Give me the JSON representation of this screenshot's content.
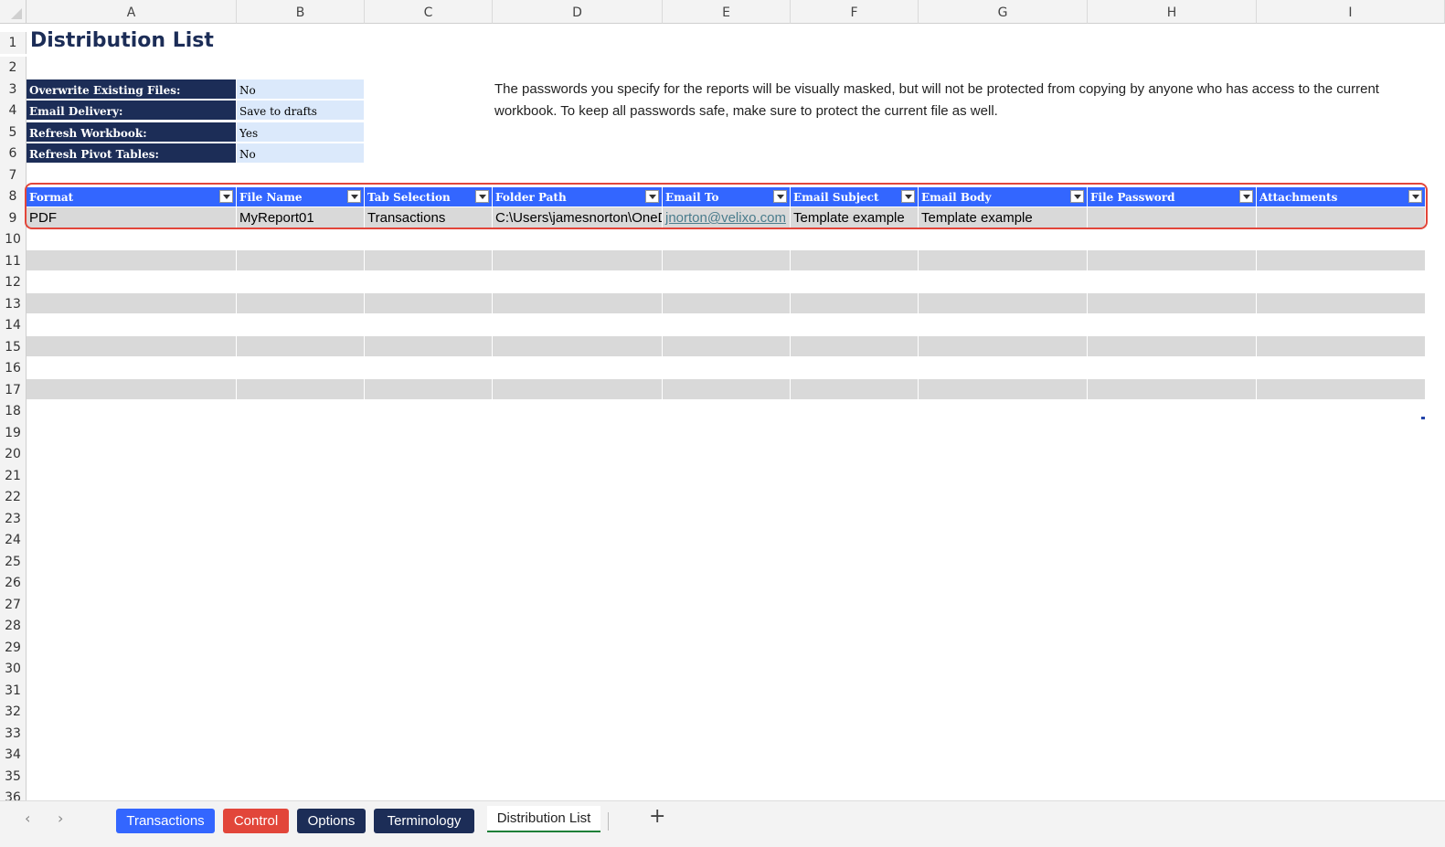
{
  "columns": [
    "A",
    "B",
    "C",
    "D",
    "E",
    "F",
    "G",
    "H",
    "I"
  ],
  "rows": [
    "1",
    "2",
    "3",
    "4",
    "5",
    "6",
    "7",
    "8",
    "9",
    "10",
    "11",
    "12",
    "13",
    "14",
    "15",
    "16",
    "17",
    "18",
    "19",
    "20",
    "21",
    "22",
    "23",
    "24",
    "25",
    "26",
    "27",
    "28",
    "29",
    "30",
    "31",
    "32",
    "33",
    "34",
    "35",
    "36"
  ],
  "title": "Distribution List",
  "settings": [
    {
      "label": "Overwrite Existing Files:",
      "value": "No"
    },
    {
      "label": "Email Delivery:",
      "value": "Save to drafts"
    },
    {
      "label": "Refresh Workbook:",
      "value": "Yes"
    },
    {
      "label": "Refresh Pivot Tables:",
      "value": "No"
    }
  ],
  "note": "The passwords you specify for the reports will be visually masked, but will not be protected from copying by anyone who has access to the current workbook. To keep all passwords safe, make sure to protect the current file as well.",
  "table": {
    "headers": [
      "Format",
      "File Name",
      "Tab Selection",
      "Folder Path",
      "Email To",
      "Email Subject",
      "Email Body",
      "File Password",
      "Attachments"
    ],
    "row": [
      "PDF",
      "MyReport01",
      "Transactions",
      "C:\\Users\\jamesnorton\\OneDrive",
      "jnorton@velixo.com",
      "Template example",
      "Template example",
      "",
      ""
    ]
  },
  "sheet_tabs": [
    {
      "label": "Transactions",
      "color": "#3366ff"
    },
    {
      "label": "Control",
      "color": "#e2463a"
    },
    {
      "label": "Options",
      "color": "#1c2d57"
    },
    {
      "label": "Terminology",
      "color": "#1c2d57"
    },
    {
      "label": "Distribution List",
      "active": true
    }
  ],
  "nav": {
    "prev": "‹",
    "next": "›",
    "add": "+"
  },
  "colors": {
    "navy": "#1c2d57",
    "header_blue": "#3366ff",
    "input_blue": "#dbe9fb",
    "band_gray": "#d9d9d9",
    "highlight_red": "#e2463a"
  }
}
